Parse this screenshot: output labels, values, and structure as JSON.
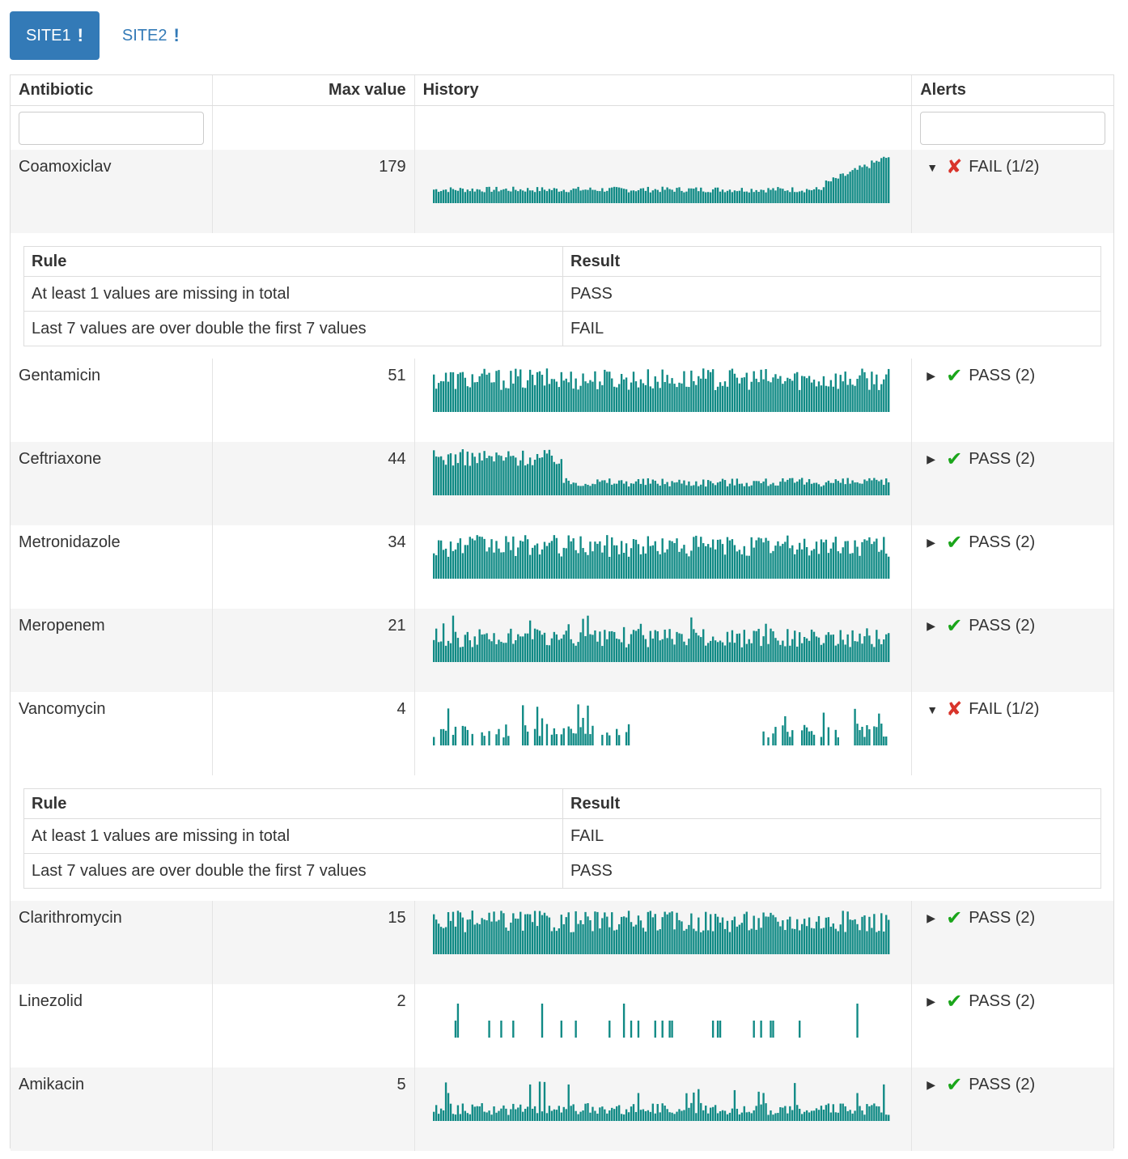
{
  "tabs": [
    {
      "label": "SITE1",
      "mark": "!",
      "active": true
    },
    {
      "label": "SITE2",
      "mark": "!",
      "active": false
    }
  ],
  "table": {
    "headers": {
      "antibiotic": "Antibiotic",
      "max": "Max value",
      "history": "History",
      "alerts": "Alerts"
    },
    "filter_antibiotic_value": "",
    "filter_alerts_value": "",
    "rows": [
      {
        "name": "Coamoxiclav",
        "max": "179",
        "status": "FAIL (1/2)",
        "ok": false,
        "expanded": true,
        "spark": "coamox"
      },
      {
        "name": "Gentamicin",
        "max": "51",
        "status": "PASS (2)",
        "ok": true,
        "expanded": false,
        "spark": "dense"
      },
      {
        "name": "Ceftriaxone",
        "max": "44",
        "status": "PASS (2)",
        "ok": true,
        "expanded": false,
        "spark": "ceftri"
      },
      {
        "name": "Metronidazole",
        "max": "34",
        "status": "PASS (2)",
        "ok": true,
        "expanded": false,
        "spark": "dense"
      },
      {
        "name": "Meropenem",
        "max": "21",
        "status": "PASS (2)",
        "ok": true,
        "expanded": false,
        "spark": "medium"
      },
      {
        "name": "Vancomycin",
        "max": "4",
        "status": "FAIL (1/2)",
        "ok": false,
        "expanded": true,
        "spark": "vanco"
      },
      {
        "name": "Clarithromycin",
        "max": "15",
        "status": "PASS (2)",
        "ok": true,
        "expanded": false,
        "spark": "dense"
      },
      {
        "name": "Linezolid",
        "max": "2",
        "status": "PASS (2)",
        "ok": true,
        "expanded": false,
        "spark": "sparse"
      },
      {
        "name": "Amikacin",
        "max": "5",
        "status": "PASS (2)",
        "ok": true,
        "expanded": false,
        "spark": "amik"
      }
    ],
    "details": {
      "Coamoxiclav": {
        "headers": [
          "Rule",
          "Result"
        ],
        "rows": [
          [
            "At least 1 values are missing in total",
            "PASS"
          ],
          [
            "Last 7 values are over double the first 7 values",
            "FAIL"
          ]
        ]
      },
      "Vancomycin": {
        "headers": [
          "Rule",
          "Result"
        ],
        "rows": [
          [
            "At least 1 values are missing in total",
            "FAIL"
          ],
          [
            "Last 7 values are over double the first 7 values",
            "PASS"
          ]
        ]
      }
    }
  },
  "colors": {
    "accent": "#337ab7",
    "spark": "#108a85",
    "fail": "#d9342b",
    "pass": "#1aa51a"
  },
  "icons": {
    "fail": "cross-icon",
    "pass": "checkmark-icon",
    "expanded": "caret-down-icon",
    "collapsed": "caret-right-icon"
  }
}
